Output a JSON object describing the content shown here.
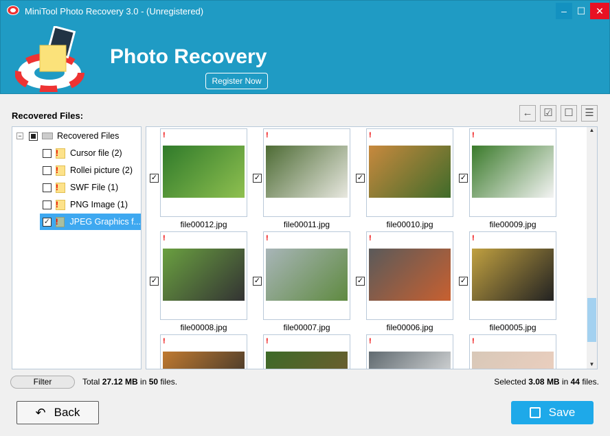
{
  "window": {
    "title": "MiniTool Photo Recovery 3.0 - (Unregistered)",
    "min": "–",
    "max": "☐",
    "close": "✕"
  },
  "header": {
    "app_title": "Photo Recovery",
    "register_label": "Register Now"
  },
  "tree": {
    "label": "Recovered Files:",
    "root": "Recovered Files",
    "items": [
      {
        "label": "Cursor file (2)",
        "checked": false
      },
      {
        "label": "Rollei picture (2)",
        "checked": false
      },
      {
        "label": "SWF File (1)",
        "checked": false
      },
      {
        "label": "PNG Image (1)",
        "checked": false
      },
      {
        "label": "JPEG Graphics f...",
        "checked": true,
        "selected": true
      }
    ]
  },
  "toolbar": {
    "back": "←",
    "check_all": "☑",
    "uncheck_all": "☐",
    "list_view": "☰"
  },
  "files": [
    {
      "name": "file00012.jpg",
      "colors": [
        "#2f7a2a",
        "#8fc050"
      ]
    },
    {
      "name": "file00011.jpg",
      "colors": [
        "#4d6b34",
        "#e8e8e0"
      ]
    },
    {
      "name": "file00010.jpg",
      "colors": [
        "#c8893e",
        "#3f6b2a"
      ]
    },
    {
      "name": "file00009.jpg",
      "colors": [
        "#3a7a2a",
        "#f4f4f4"
      ]
    },
    {
      "name": "file00008.jpg",
      "colors": [
        "#6aa040",
        "#333333"
      ]
    },
    {
      "name": "file00007.jpg",
      "colors": [
        "#a8b5b8",
        "#5f8a40"
      ]
    },
    {
      "name": "file00006.jpg",
      "colors": [
        "#5a5a5a",
        "#c86030"
      ]
    },
    {
      "name": "file00005.jpg",
      "colors": [
        "#c0a040",
        "#222222"
      ]
    },
    {
      "name": "",
      "colors": [
        "#c07a30",
        "#2a2a2a"
      ]
    },
    {
      "name": "",
      "colors": [
        "#3c6a28",
        "#7a5a30"
      ]
    },
    {
      "name": "",
      "colors": [
        "#606a70",
        "#f0f0f0"
      ]
    },
    {
      "name": "",
      "colors": [
        "#d8c8b8",
        "#f0d0c0"
      ]
    }
  ],
  "status": {
    "filter": "Filter",
    "total_prefix": "Total ",
    "total_size": "27.12 MB",
    "total_mid": " in ",
    "total_count": "50",
    "total_suffix": " files.",
    "sel_prefix": "Selected ",
    "sel_size": "3.08 MB",
    "sel_mid": " in ",
    "sel_count": "44",
    "sel_suffix": " files."
  },
  "footer": {
    "back": "Back",
    "save": "Save"
  }
}
